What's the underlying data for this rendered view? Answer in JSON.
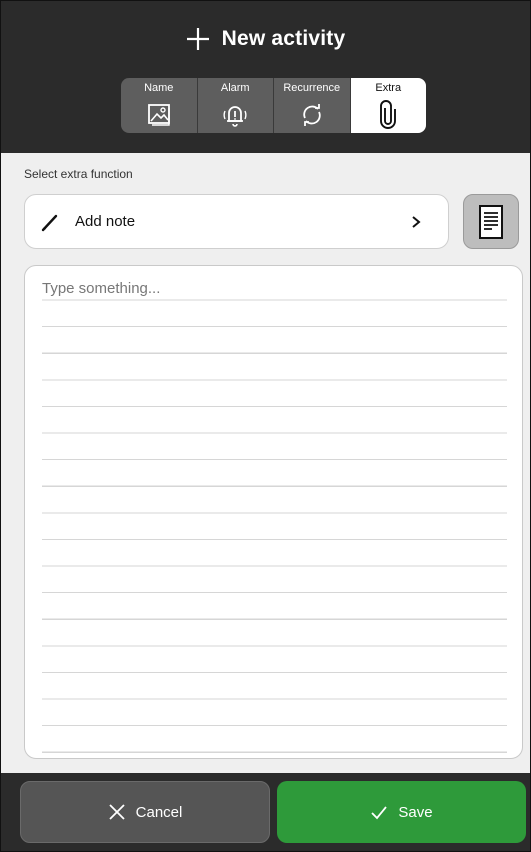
{
  "header": {
    "title": "New activity",
    "title_icon": "plus-icon",
    "tabs": [
      {
        "label": "Name",
        "icon": "image-icon",
        "active": false
      },
      {
        "label": "Alarm",
        "icon": "alarm-bell-icon",
        "active": false
      },
      {
        "label": "Recurrence",
        "icon": "refresh-icon",
        "active": false
      },
      {
        "label": "Extra",
        "icon": "paperclip-icon",
        "active": true
      }
    ]
  },
  "extra": {
    "section_label": "Select extra function",
    "selected_function": "Add note",
    "selected_icon": "pencil-icon",
    "side_button_icon": "document-icon"
  },
  "note": {
    "placeholder": "Type something...",
    "value": ""
  },
  "footer": {
    "cancel_label": "Cancel",
    "save_label": "Save"
  },
  "colors": {
    "header_bg": "#2b2b2b",
    "save_green": "#2e9a3a",
    "cancel_gray": "#555555"
  }
}
